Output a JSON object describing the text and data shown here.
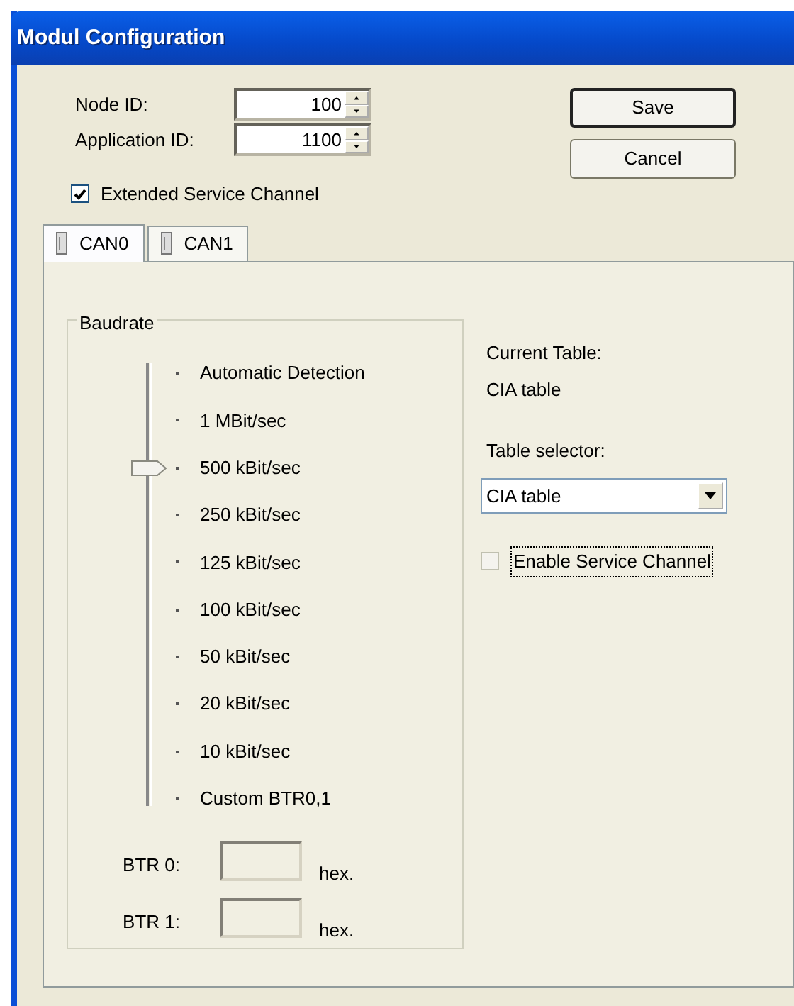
{
  "window": {
    "title": "Modul Configuration"
  },
  "fields": [
    {
      "label": "Node ID:",
      "value": "100"
    },
    {
      "label": "Application ID:",
      "value": "1100"
    }
  ],
  "buttons": [
    {
      "label": "Save",
      "default": true
    },
    {
      "label": "Cancel",
      "default": false
    }
  ],
  "extended_service_channel": {
    "label": "Extended Service Channel",
    "checked": true
  },
  "tabs": [
    {
      "label": "CAN0",
      "selected": true
    },
    {
      "label": "CAN1",
      "selected": false
    }
  ],
  "baudrate": {
    "title": "Baudrate",
    "level": 0.7778,
    "options": [
      {
        "label": "Automatic Detection"
      },
      {
        "label": "1 MBit/sec"
      },
      {
        "label": "500 kBit/sec"
      },
      {
        "label": "250 kBit/sec"
      },
      {
        "label": "125 kBit/sec"
      },
      {
        "label": "100 kBit/sec"
      },
      {
        "label": "50 kBit/sec"
      },
      {
        "label": "20 kBit/sec"
      },
      {
        "label": "10 kBit/sec"
      },
      {
        "label": "Custom BTR0,1"
      }
    ],
    "btr": [
      {
        "label": "BTR 0:",
        "unit": "hex."
      },
      {
        "label": "BTR 1:",
        "unit": "hex."
      }
    ]
  },
  "current_table": {
    "label": "Current Table:",
    "value": "CIA table"
  },
  "table_selector": {
    "label": "Table selector:",
    "value": "CIA table"
  },
  "enable_service_channel": {
    "label": "Enable Service Channel",
    "checked": false,
    "focused": true
  }
}
